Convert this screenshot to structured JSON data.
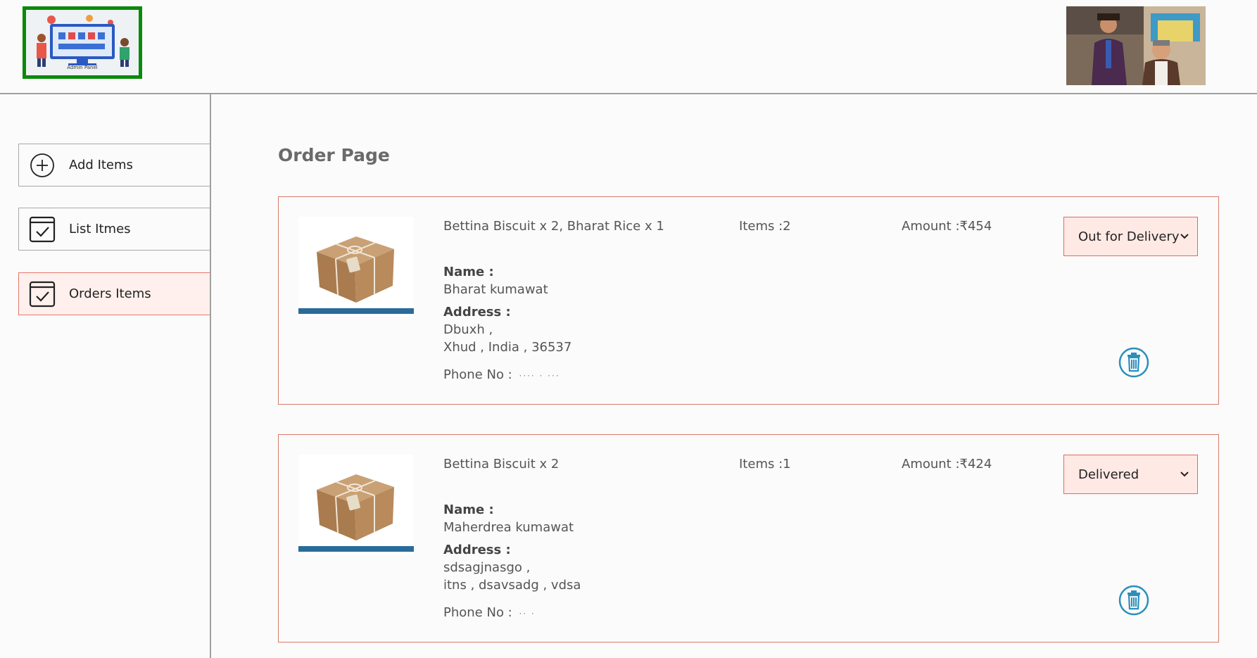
{
  "header": {
    "logo_caption": "Admin Panel",
    "logo_icon": "admin-panel-logo",
    "profile_icon": "profile-photo"
  },
  "sidebar": {
    "items": [
      {
        "label": "Add Items",
        "icon": "add-circle-icon",
        "active": false
      },
      {
        "label": "List Itmes",
        "icon": "checkbox-icon",
        "active": false
      },
      {
        "label": "Orders Items",
        "icon": "checkbox-icon",
        "active": true
      }
    ]
  },
  "main": {
    "title": "Order Page",
    "orders": [
      {
        "items": "Bettina Biscuit x 2, Bharat Rice x 1",
        "count": "Items :2",
        "amount": "Amount :₹454",
        "status": "Out for Delivery",
        "name_label": "Name :",
        "name": "Bharat kumawat",
        "address_label": "Address :",
        "address_line1": "Dbuxh ,",
        "address_line2": "Xhud , India , 36537",
        "phone_label": "Phone No :",
        "phone": "···· · ···"
      },
      {
        "items": "Bettina Biscuit x 2",
        "count": "Items :1",
        "amount": "Amount :₹424",
        "status": "Delivered",
        "name_label": "Name :",
        "name": "Maherdrea kumawat",
        "address_label": "Address :",
        "address_line1": "sdsagjnasgo ,",
        "address_line2": "itns , dsavsadg , vdsa",
        "phone_label": "Phone No :",
        "phone": "·· ·"
      }
    ]
  },
  "colors": {
    "accent": "#e06b5b",
    "active_bg": "#fff0ed",
    "logo_border": "#0a8a0a",
    "delete_icon": "#2a8fbd"
  }
}
